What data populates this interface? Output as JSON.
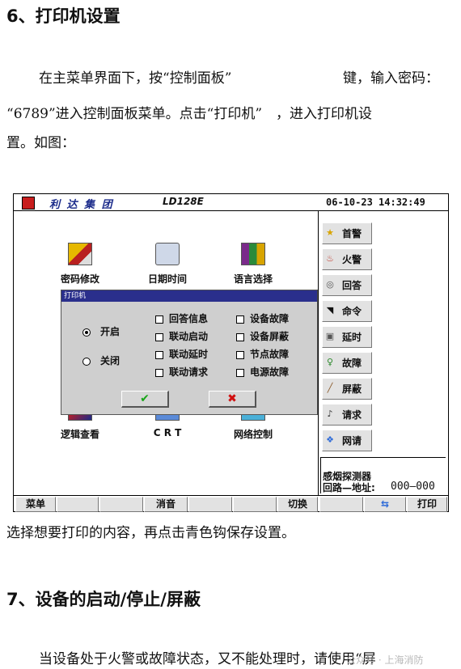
{
  "doc": {
    "heading6": "6、打印机设置",
    "para1_line1_a": "在主菜单界面下，按“控制面板”",
    "para1_line1_b": "键，输入密码：",
    "para1_line2": "“6789”进入控制面板菜单。点击“打印机”　，进入打印机设",
    "para1_line3": "置。如图：",
    "caption": "选择想要打印的内容，再点击青色钩保存设置。",
    "heading7": "7、设备的启动/停止/屏蔽",
    "para2": "当设备处于火警或故障状态，又不能处理时，请使用“屏",
    "watermark": "公众号 · 上海消防"
  },
  "panel": {
    "brand": "利 达 集 团",
    "model": "LD128E",
    "datetime": "06-10-23 14:32:49",
    "icons": [
      {
        "label": "密码修改",
        "icon": "key-document-icon"
      },
      {
        "label": "日期时间",
        "icon": "clock-folder-icon"
      },
      {
        "label": "语言选择",
        "icon": "language-books-icon"
      },
      {
        "label": "逻辑查看",
        "icon": "logic-view-icon"
      },
      {
        "label": "C R T",
        "icon": "crt-computer-icon"
      },
      {
        "label": "网络控制",
        "icon": "network-computer-icon"
      }
    ],
    "sidebar": [
      {
        "label": "首警",
        "icon": "star-icon",
        "color": "#d8a400"
      },
      {
        "label": "火警",
        "icon": "flame-icon",
        "color": "#c0392b"
      },
      {
        "label": "回答",
        "icon": "reply-icon",
        "color": "#555555"
      },
      {
        "label": "命令",
        "icon": "command-icon",
        "color": "#111111"
      },
      {
        "label": "延时",
        "icon": "delay-icon",
        "color": "#555555"
      },
      {
        "label": "故障",
        "icon": "bulb-icon",
        "color": "#2e8b2e"
      },
      {
        "label": "屏蔽",
        "icon": "shield-pen-icon",
        "color": "#8a5a2b"
      },
      {
        "label": "请求",
        "icon": "request-icon",
        "color": "#333333"
      },
      {
        "label": "网请",
        "icon": "network-request-icon",
        "color": "#2e6bd8"
      }
    ],
    "info": {
      "line1": "感烟探测器",
      "line2_label": "回路—地址:",
      "line2_value": "000—000"
    },
    "bottom": {
      "menu": "菜单",
      "mute": "消音",
      "switch": "切换",
      "print": "打印"
    },
    "dialog": {
      "title": "打印机",
      "radio_on": "开启",
      "radio_off": "关闭",
      "checks": [
        "回答信息",
        "联动启动",
        "联动延时",
        "联动请求",
        "设备故障",
        "设备屏蔽",
        "节点故障",
        "电源故障"
      ],
      "ok": "✔",
      "cancel": "✖",
      "ok_color": "#17a517",
      "cancel_color": "#d01010"
    }
  }
}
